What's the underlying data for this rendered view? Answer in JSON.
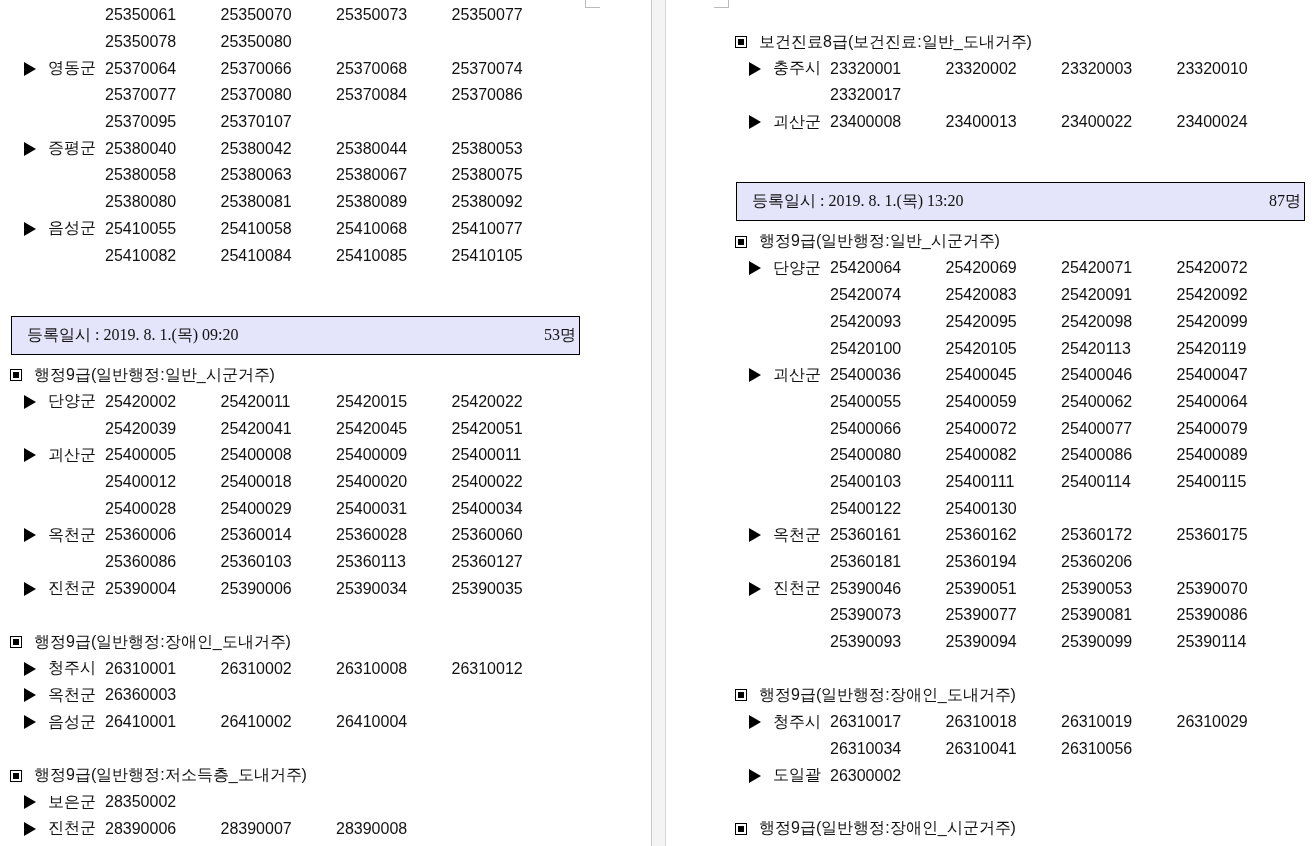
{
  "pages": [
    {
      "blocks": [
        {
          "kind": "group",
          "districts": [
            {
              "codes": [
                "25350061",
                "25350070",
                "25350073",
                "25350077",
                "25350078",
                "25350080"
              ]
            },
            {
              "name": "영동군",
              "codes": [
                "25370064",
                "25370066",
                "25370068",
                "25370074",
                "25370077",
                "25370080",
                "25370084",
                "25370086",
                "25370095",
                "25370107"
              ]
            },
            {
              "name": "증평군",
              "codes": [
                "25380040",
                "25380042",
                "25380044",
                "25380053",
                "25380058",
                "25380063",
                "25380067",
                "25380075",
                "25380080",
                "25380081",
                "25380089",
                "25380092"
              ]
            },
            {
              "name": "음성군",
              "codes": [
                "25410055",
                "25410058",
                "25410068",
                "25410077",
                "25410082",
                "25410084",
                "25410085",
                "25410105"
              ]
            }
          ]
        },
        {
          "kind": "header",
          "label": "등록일시 : 2019. 8. 1.(목) 09:20",
          "count": "53명"
        },
        {
          "kind": "group",
          "title": "행정9급(일반행정:일반_시군거주)",
          "districts": [
            {
              "name": "단양군",
              "codes": [
                "25420002",
                "25420011",
                "25420015",
                "25420022",
                "25420039",
                "25420041",
                "25420045",
                "25420051"
              ]
            },
            {
              "name": "괴산군",
              "codes": [
                "25400005",
                "25400008",
                "25400009",
                "25400011",
                "25400012",
                "25400018",
                "25400020",
                "25400022",
                "25400028",
                "25400029",
                "25400031",
                "25400034"
              ]
            },
            {
              "name": "옥천군",
              "codes": [
                "25360006",
                "25360014",
                "25360028",
                "25360060",
                "25360086",
                "25360103",
                "25360113",
                "25360127"
              ]
            },
            {
              "name": "진천군",
              "codes": [
                "25390004",
                "25390006",
                "25390034",
                "25390035"
              ]
            }
          ]
        },
        {
          "kind": "group",
          "title": "행정9급(일반행정:장애인_도내거주)",
          "districts": [
            {
              "name": "청주시",
              "codes": [
                "26310001",
                "26310002",
                "26310008",
                "26310012"
              ]
            },
            {
              "name": "옥천군",
              "codes": [
                "26360003"
              ]
            },
            {
              "name": "음성군",
              "codes": [
                "26410001",
                "26410002",
                "26410004"
              ]
            }
          ]
        },
        {
          "kind": "group",
          "title": "행정9급(일반행정:저소득층_도내거주)",
          "districts": [
            {
              "name": "보은군",
              "codes": [
                "28350002"
              ]
            },
            {
              "name": "진천군",
              "codes": [
                "28390006",
                "28390007",
                "28390008"
              ]
            }
          ]
        }
      ]
    },
    {
      "blocks": [
        {
          "kind": "group",
          "title": "보건진료8급(보건진료:일반_도내거주)",
          "districts": [
            {
              "name": "충주시",
              "codes": [
                "23320001",
                "23320002",
                "23320003",
                "23320010",
                "23320017"
              ]
            },
            {
              "name": "괴산군",
              "codes": [
                "23400008",
                "23400013",
                "23400022",
                "23400024"
              ]
            }
          ]
        },
        {
          "kind": "header",
          "label": "등록일시 : 2019. 8. 1.(목) 13:20",
          "count": "87명"
        },
        {
          "kind": "group",
          "title": "행정9급(일반행정:일반_시군거주)",
          "districts": [
            {
              "name": "단양군",
              "codes": [
                "25420064",
                "25420069",
                "25420071",
                "25420072",
                "25420074",
                "25420083",
                "25420091",
                "25420092",
                "25420093",
                "25420095",
                "25420098",
                "25420099",
                "25420100",
                "25420105",
                "25420113",
                "25420119"
              ]
            },
            {
              "name": "괴산군",
              "codes": [
                "25400036",
                "25400045",
                "25400046",
                "25400047",
                "25400055",
                "25400059",
                "25400062",
                "25400064",
                "25400066",
                "25400072",
                "25400077",
                "25400079",
                "25400080",
                "25400082",
                "25400086",
                "25400089",
                "25400103",
                "25400111",
                "25400114",
                "25400115",
                "25400122",
                "25400130"
              ]
            },
            {
              "name": "옥천군",
              "codes": [
                "25360161",
                "25360162",
                "25360172",
                "25360175",
                "25360181",
                "25360194",
                "25360206"
              ]
            },
            {
              "name": "진천군",
              "codes": [
                "25390046",
                "25390051",
                "25390053",
                "25390070",
                "25390073",
                "25390077",
                "25390081",
                "25390086",
                "25390093",
                "25390094",
                "25390099",
                "25390114"
              ]
            }
          ]
        },
        {
          "kind": "group",
          "title": "행정9급(일반행정:장애인_도내거주)",
          "districts": [
            {
              "name": "청주시",
              "codes": [
                "26310017",
                "26310018",
                "26310019",
                "26310029",
                "26310034",
                "26310041",
                "26310056"
              ]
            },
            {
              "name": "도일괄",
              "codes": [
                "26300002"
              ]
            }
          ]
        },
        {
          "kind": "group",
          "title": "행정9급(일반행정:장애인_시군거주)"
        }
      ]
    }
  ]
}
